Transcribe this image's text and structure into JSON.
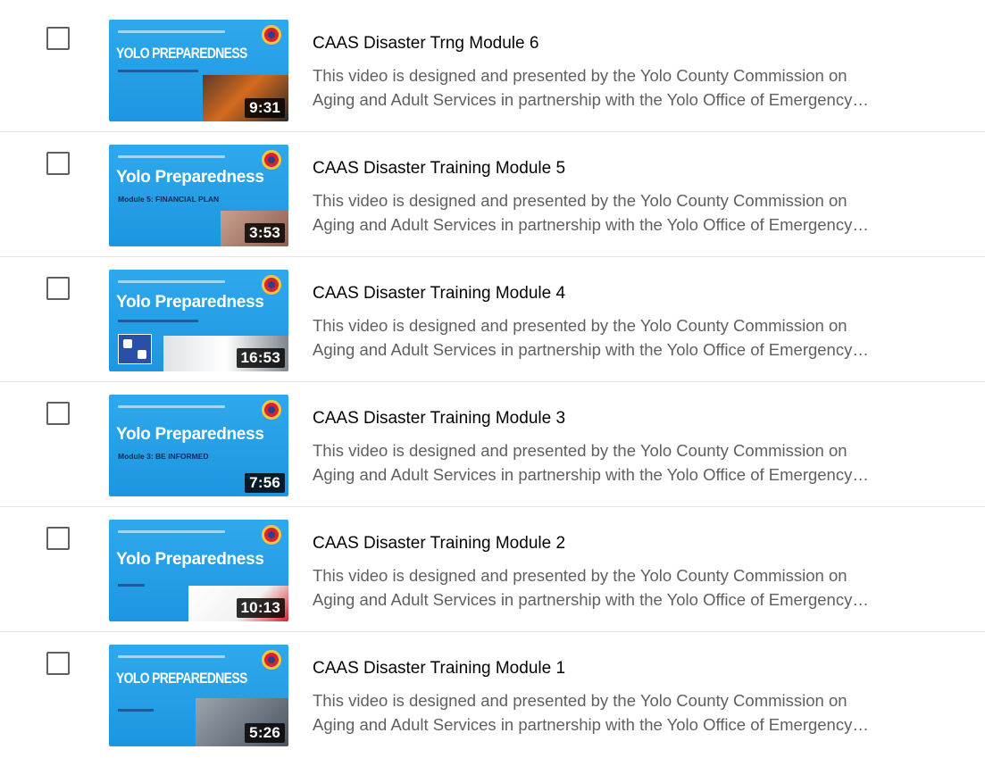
{
  "videos": [
    {
      "title": "CAAS Disaster Trng Module 6",
      "duration": "9:31",
      "thumb_brand": "YOLO PREPAREDNESS",
      "thumb_sub": "",
      "desc_line1": "This video is designed and presented by the Yolo County Commission on",
      "desc_line2": "Aging and Adult Services in partnership with the Yolo Office of Emergency…"
    },
    {
      "title": "CAAS Disaster Training Module 5",
      "duration": "3:53",
      "thumb_brand": "Yolo Preparedness",
      "thumb_sub": "Module 5: FINANCIAL PLAN",
      "desc_line1": "This video is designed and presented by the Yolo County Commission on",
      "desc_line2": "Aging and Adult Services in partnership with the Yolo Office of Emergency…"
    },
    {
      "title": "CAAS Disaster Training Module 4",
      "duration": "16:53",
      "thumb_brand": "Yolo Preparedness",
      "thumb_sub": "",
      "desc_line1": "This video is designed and presented by the Yolo County Commission on",
      "desc_line2": "Aging and Adult Services in partnership with the Yolo Office of Emergency…"
    },
    {
      "title": "CAAS Disaster Training Module 3",
      "duration": "7:56",
      "thumb_brand": "Yolo Preparedness",
      "thumb_sub": "Module 3: BE INFORMED",
      "desc_line1": "This video is designed and presented by the Yolo County Commission on",
      "desc_line2": "Aging and Adult Services in partnership with the Yolo Office of Emergency…"
    },
    {
      "title": "CAAS Disaster Training Module 2",
      "duration": "10:13",
      "thumb_brand": "Yolo Preparedness",
      "thumb_sub": "",
      "desc_line1": "This video is designed and presented by the Yolo County Commission on",
      "desc_line2": "Aging and Adult Services in partnership with the Yolo Office of Emergency…"
    },
    {
      "title": "CAAS Disaster Training Module 1",
      "duration": "5:26",
      "thumb_brand": "YOLO PREPAREDNESS",
      "thumb_sub": "",
      "desc_line1": "This video is designed and presented by the Yolo County Commission on",
      "desc_line2": "Aging and Adult Services in partnership with the Yolo Office of Emergency…"
    }
  ]
}
